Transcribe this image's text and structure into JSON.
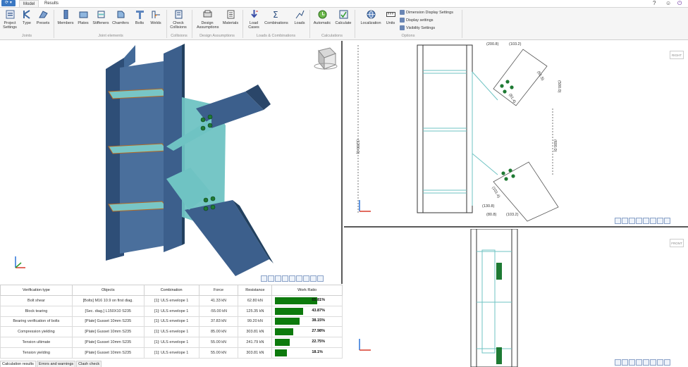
{
  "app": {
    "menu_label": "⟳ ▾"
  },
  "tabs": [
    {
      "label": "Model"
    },
    {
      "label": "Results"
    }
  ],
  "window_controls": [
    "?",
    "☺",
    "⏻"
  ],
  "ribbon": {
    "buttons": [
      {
        "label": "Project Settings",
        "icon": "project-settings-icon"
      },
      {
        "label": "Type",
        "icon": "type-icon"
      },
      {
        "label": "Presets",
        "icon": "presets-icon"
      },
      {
        "label": "Members",
        "icon": "members-icon"
      },
      {
        "label": "Plates",
        "icon": "plates-icon"
      },
      {
        "label": "Stiffeners",
        "icon": "stiffeners-icon"
      },
      {
        "label": "Chamfers",
        "icon": "chamfers-icon"
      },
      {
        "label": "Bolts",
        "icon": "bolts-icon"
      },
      {
        "label": "Welds",
        "icon": "welds-icon"
      },
      {
        "label": "Check Collisions",
        "icon": "check-collisions-icon"
      },
      {
        "label": "Design Assumptions",
        "icon": "design-assumptions-icon"
      },
      {
        "label": "Materials",
        "icon": "materials-icon"
      },
      {
        "label": "Load Cases",
        "icon": "load-cases-icon"
      },
      {
        "label": "Combinations",
        "icon": "combinations-icon"
      },
      {
        "label": "Loads",
        "icon": "loads-icon"
      },
      {
        "label": "Automatic",
        "icon": "automatic-icon"
      },
      {
        "label": "Calculate",
        "icon": "calculate-icon"
      },
      {
        "label": "Localization",
        "icon": "localization-icon"
      },
      {
        "label": "Units",
        "icon": "units-icon"
      }
    ],
    "groups": [
      "Joints",
      "Joint elements",
      "Collisions",
      "Design Assumptions",
      "Loads & Combinations",
      "Calculations",
      "Options"
    ],
    "options": [
      "Dimension Display Settings",
      "Display settings",
      "Visibility Settings"
    ]
  },
  "drawing_top": {
    "dims": [
      "(200.8)",
      "(103.2)",
      "(1200.0)",
      "(500.0)",
      "(61.5)",
      "(81.4)",
      "(600.0)",
      "(101.4)",
      "(130.8)",
      "(103.2)",
      "(80.8)"
    ],
    "view_label": "RIGHT"
  },
  "drawing_bottom": {
    "view_label": "FRONT"
  },
  "results": {
    "headers": [
      "Verification type",
      "Objects",
      "Combination",
      "Force",
      "Resistance",
      "Work Ratio"
    ],
    "rows": [
      {
        "type": "Bolt shear",
        "objects": "[Bolts] M16 10.9 on first diag.",
        "combination": "[1]: ULS envelope 1",
        "force": "41.33 kN",
        "resistance": "62.80 kN",
        "ratio": 65.81,
        "ratio_text": "65.81%"
      },
      {
        "type": "Block tearing",
        "objects": "[Sec. diag.] L150X10 S235",
        "combination": "[1]: ULS envelope 1",
        "force": "-55.00 kN",
        "resistance": "125.35 kN",
        "ratio": 43.87,
        "ratio_text": "43.87%"
      },
      {
        "type": "Bearing verification of bolts",
        "objects": "[Plate] Gusset 10mm S235",
        "combination": "[1]: ULS envelope 1",
        "force": "37.83 kN",
        "resistance": "99.20 kN",
        "ratio": 38.15,
        "ratio_text": "38.15%"
      },
      {
        "type": "Compression yielding",
        "objects": "[Plate] Gusset 10mm S235",
        "combination": "[1]: ULS envelope 1",
        "force": "85.00 kN",
        "resistance": "303.81 kN",
        "ratio": 27.98,
        "ratio_text": "27.98%"
      },
      {
        "type": "Tension ultimate",
        "objects": "[Plate] Gusset 10mm S235",
        "combination": "[1]: ULS envelope 1",
        "force": "55.00 kN",
        "resistance": "241.79 kN",
        "ratio": 22.75,
        "ratio_text": "22.75%"
      },
      {
        "type": "Tension yielding",
        "objects": "[Plate] Gusset 10mm S235",
        "combination": "[1]: ULS envelope 1",
        "force": "55.00 kN",
        "resistance": "303.81 kN",
        "ratio": 18.1,
        "ratio_text": "18.1%"
      }
    ]
  },
  "bottom_tabs": [
    "Calculation results",
    "Errors and warnings",
    "Clash check"
  ],
  "colors": {
    "accent": "#3b78c2",
    "ok_bar": "#0d7a0d",
    "steel": "#3a5c84",
    "plate": "#6fc3c3"
  }
}
